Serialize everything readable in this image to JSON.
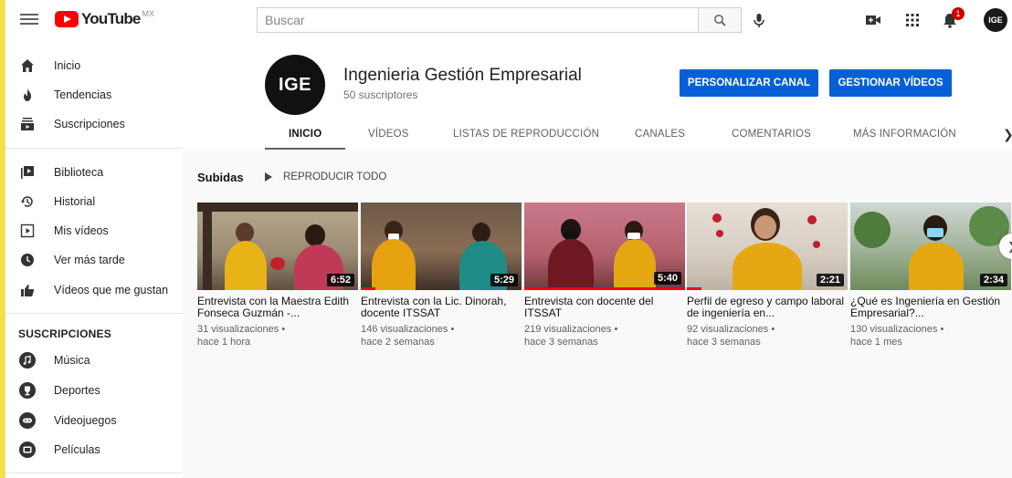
{
  "header": {
    "logo_text": "YouTube",
    "region": "MX",
    "search_placeholder": "Buscar",
    "notification_count": "1",
    "avatar_text": "IGE"
  },
  "sidebar": {
    "main_items": [
      {
        "label": "Inicio",
        "icon": "home-icon"
      },
      {
        "label": "Tendencias",
        "icon": "fire-icon"
      },
      {
        "label": "Suscripciones",
        "icon": "subscriptions-icon"
      }
    ],
    "library_items": [
      {
        "label": "Biblioteca",
        "icon": "library-icon"
      },
      {
        "label": "Historial",
        "icon": "history-icon"
      },
      {
        "label": "Mis vídeos",
        "icon": "my-videos-icon"
      },
      {
        "label": "Ver más tarde",
        "icon": "clock-icon"
      },
      {
        "label": "Vídeos que me gustan",
        "icon": "thumbs-up-icon"
      }
    ],
    "subscriptions_heading": "SUSCRIPCIONES",
    "subscriptions": [
      {
        "label": "Música",
        "icon": "music-icon"
      },
      {
        "label": "Deportes",
        "icon": "trophy-icon"
      },
      {
        "label": "Videojuegos",
        "icon": "gamepad-icon"
      },
      {
        "label": "Películas",
        "icon": "film-icon"
      }
    ]
  },
  "channel": {
    "avatar_text": "IGE",
    "name": "Ingenieria Gestión Empresarial",
    "subscribers": "50 suscriptores",
    "customize_button": "PERSONALIZAR CANAL",
    "manage_button": "GESTIONAR VÍDEOS",
    "accent_color": "#065fd4",
    "tabs": [
      "INICIO",
      "VÍDEOS",
      "LISTAS DE REPRODUCCIÓN",
      "CANALES",
      "COMENTARIOS",
      "MÁS INFORMACIÓN"
    ],
    "active_tab": "INICIO"
  },
  "uploads": {
    "title": "Subidas",
    "play_all": "REPRODUCIR TODO",
    "videos": [
      {
        "title": "Entrevista con la Maestra Edith Fonseca Guzmán -...",
        "duration": "6:52",
        "views": "31 visualizaciones •",
        "age": "hace 1 hora"
      },
      {
        "title": "Entrevista con la Lic. Dinorah, docente ITSSAT",
        "duration": "5:29",
        "views": "146 visualizaciones •",
        "age": "hace 2 semanas"
      },
      {
        "title": "Entrevista con docente del ITSSAT",
        "duration": "5:40",
        "views": "219 visualizaciones •",
        "age": "hace 3 semanas"
      },
      {
        "title": "Perfil de egreso y campo laboral de ingeniería en...",
        "duration": "2:21",
        "views": "92 visualizaciones •",
        "age": "hace 3 semanas"
      },
      {
        "title": "¿Qué es Ingeniería en Gestión Empresarial?...",
        "duration": "2:34",
        "views": "130 visualizaciones •",
        "age": "hace 1 mes"
      }
    ]
  }
}
